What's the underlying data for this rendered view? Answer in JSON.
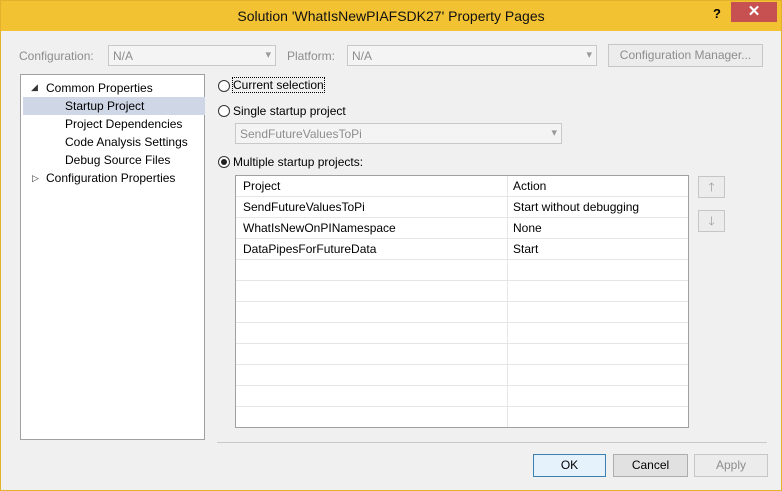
{
  "window": {
    "title": "Solution 'WhatIsNewPIAFSDK27' Property Pages",
    "help_glyph": "?",
    "close_glyph": "✕"
  },
  "top_bar": {
    "configuration_label": "Configuration:",
    "configuration_value": "N/A",
    "platform_label": "Platform:",
    "platform_value": "N/A",
    "config_manager_label": "Configuration Manager..."
  },
  "tree": {
    "items": [
      {
        "label": "Common Properties",
        "expanded": true
      },
      {
        "label": "Startup Project",
        "selected": true
      },
      {
        "label": "Project Dependencies"
      },
      {
        "label": "Code Analysis Settings"
      },
      {
        "label": "Debug Source Files"
      },
      {
        "label": "Configuration Properties",
        "expanded": false
      }
    ]
  },
  "startup": {
    "current_selection_label": "Current selection",
    "single_label": "Single startup project",
    "single_value": "SendFutureValuesToPi",
    "multiple_label": "Multiple startup projects:",
    "selected_option": "multiple"
  },
  "grid": {
    "headers": [
      "Project",
      "Action"
    ],
    "rows": [
      {
        "project": "SendFutureValuesToPi",
        "action": "Start without debugging"
      },
      {
        "project": "WhatIsNewOnPINamespace",
        "action": "None"
      },
      {
        "project": "DataPipesForFutureData",
        "action": "Start"
      }
    ]
  },
  "side_buttons": {
    "up_glyph": "🡑",
    "down_glyph": "🡓"
  },
  "footer": {
    "ok_label": "OK",
    "cancel_label": "Cancel",
    "apply_label": "Apply"
  },
  "colors": {
    "title_bar": "#f2c233",
    "close_button": "#c75050",
    "selection": "#cfd6e5"
  }
}
